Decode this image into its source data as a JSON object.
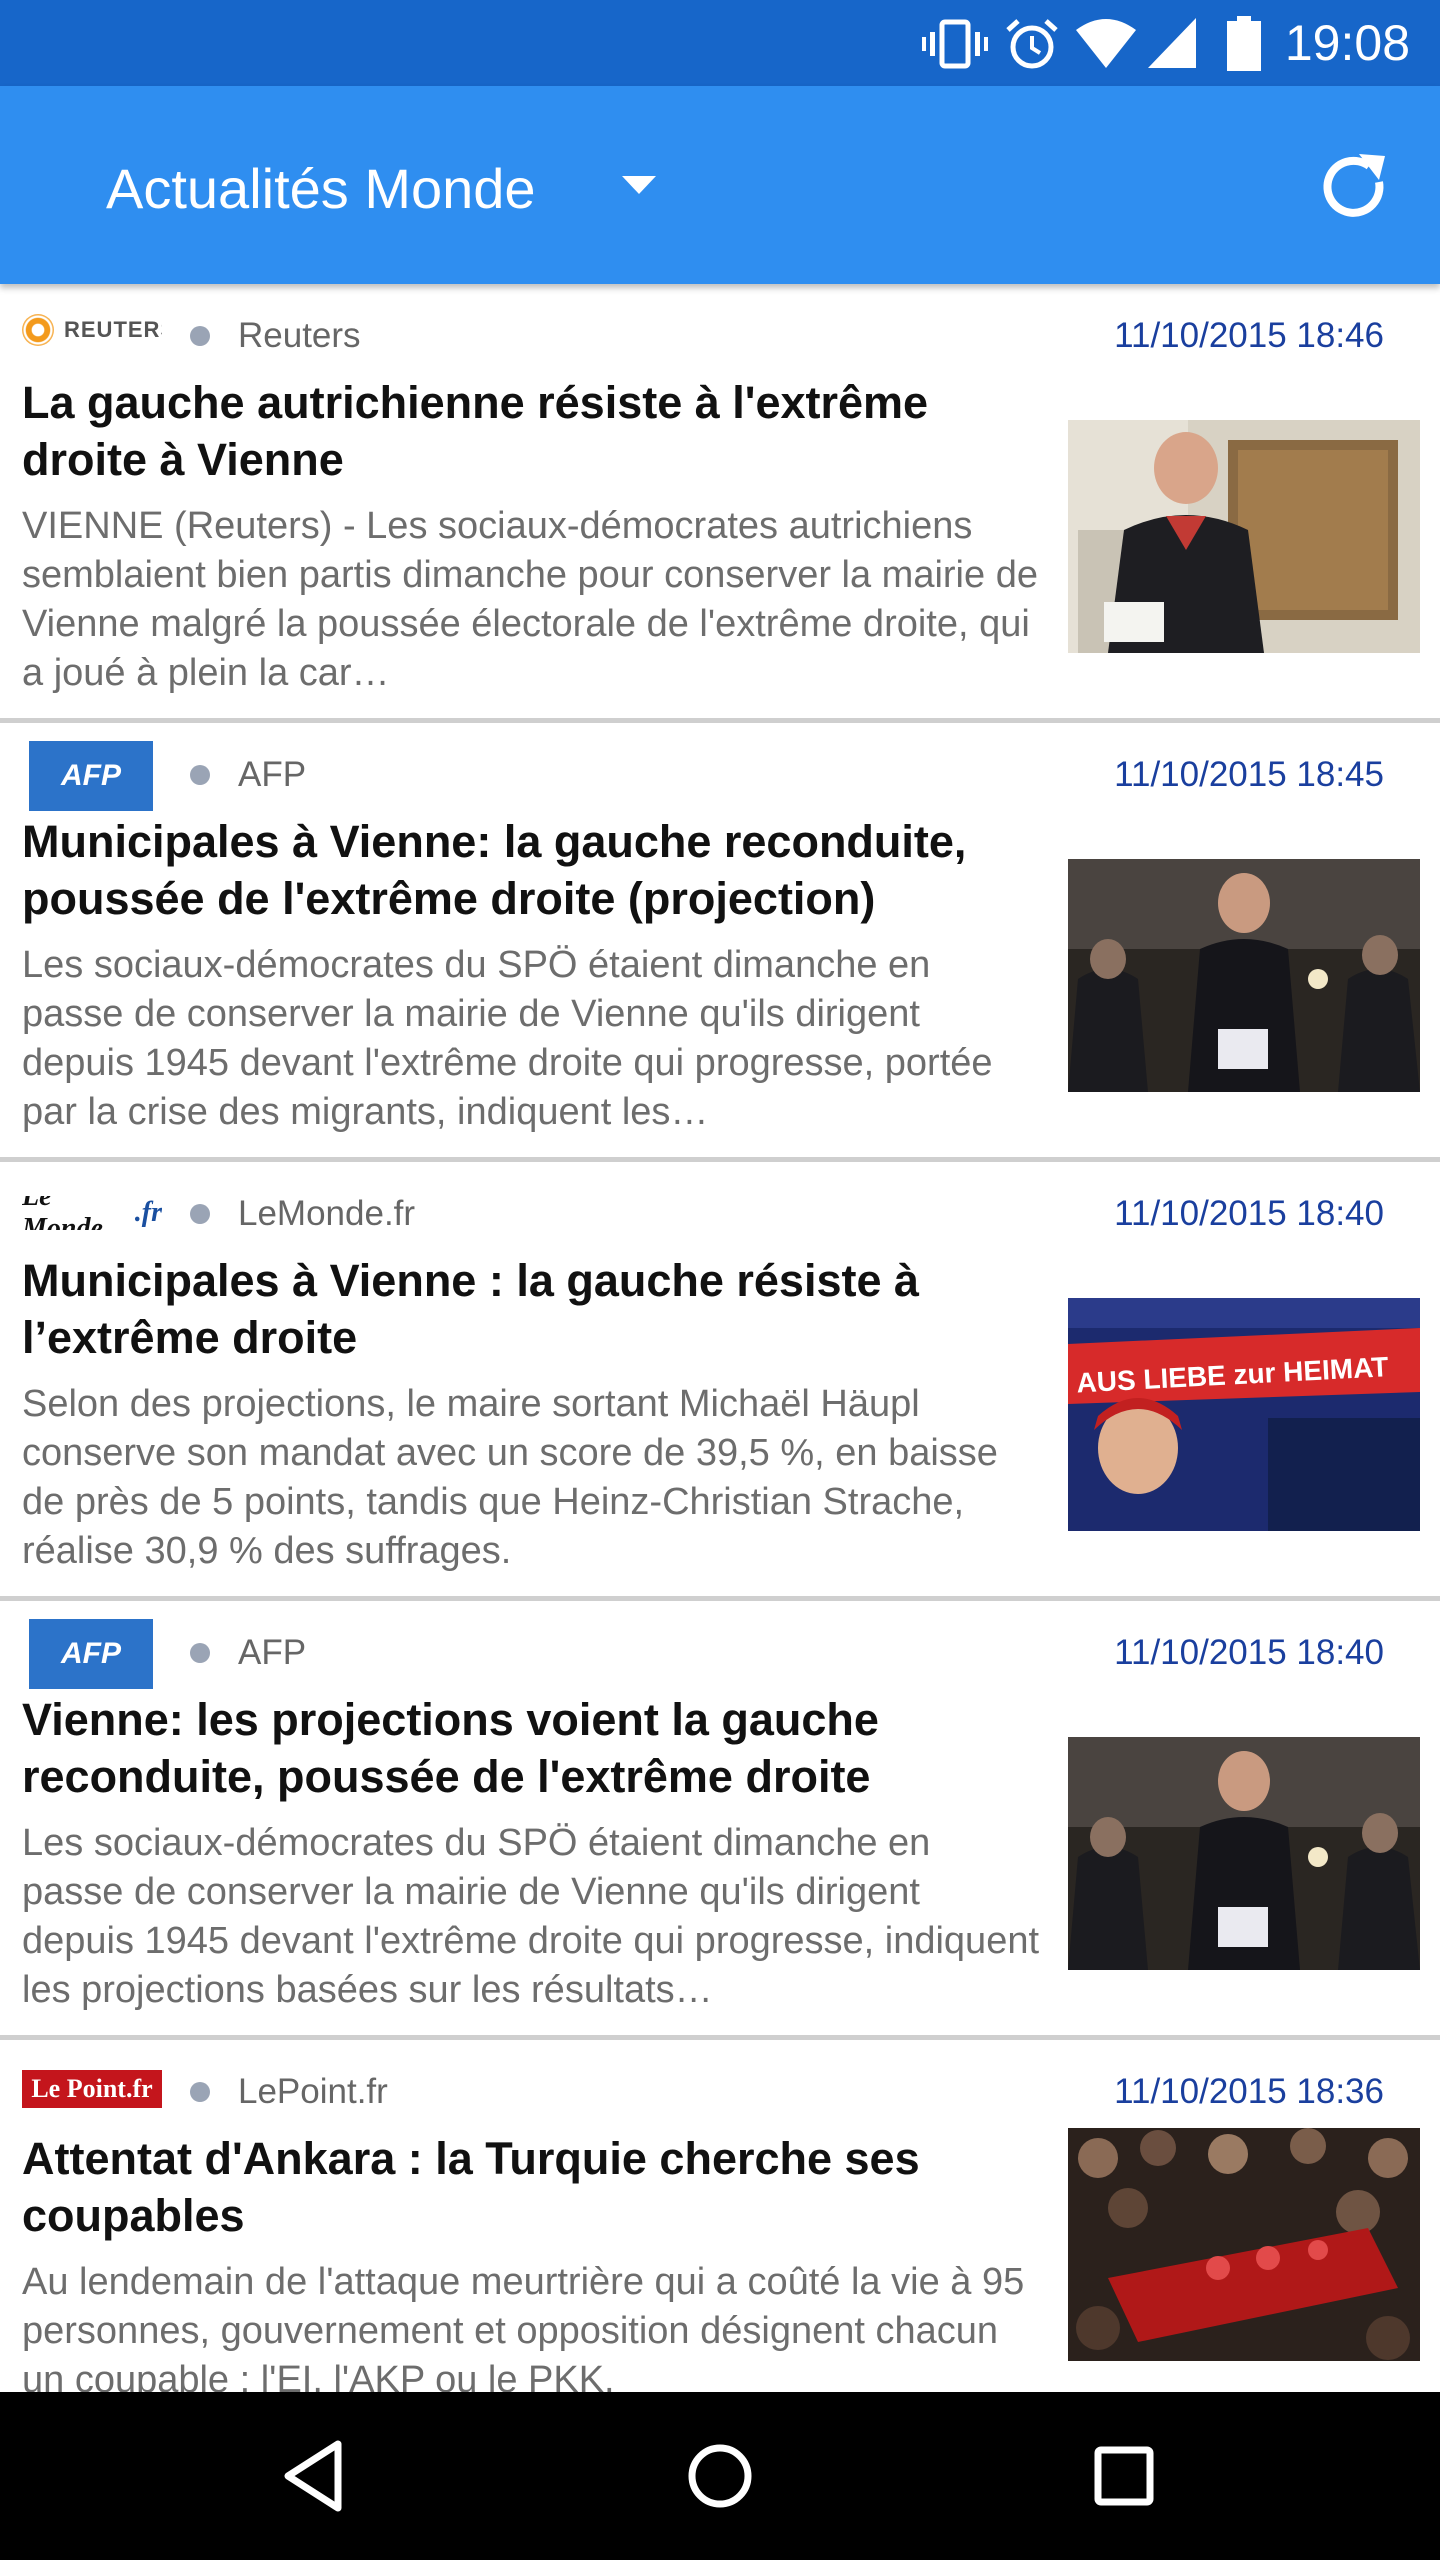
{
  "status_bar": {
    "time": "19:08",
    "icons": [
      "vibrate-icon",
      "alarm-icon",
      "wifi-icon",
      "signal-icon",
      "battery-icon"
    ]
  },
  "app_bar": {
    "title": "Actualités Monde",
    "dropdown_icon": "dropdown-arrow-icon",
    "refresh_icon": "refresh-icon"
  },
  "articles": [
    {
      "logo": "reuters-logo",
      "logo_text": "REUTERS",
      "source": "Reuters",
      "date": "11/10/2015 18:46",
      "title": "La gauche autrichienne résiste à l'extrême droite à Vienne",
      "summary": "VIENNE (Reuters) - Les sociaux-démocrates autrichiens semblaient bien partis dimanche pour conserver la mairie de Vienne malgré la poussée électorale de l'extrême droite, qui a joué à plein la car…"
    },
    {
      "logo": "afp-logo",
      "logo_text": "AFP",
      "source": "AFP",
      "date": "11/10/2015 18:45",
      "title": "Municipales à Vienne: la gauche reconduite, poussée de l'extrême droite (projection)",
      "summary": "Les sociaux-démocrates du SPÖ étaient dimanche en passe de conserver la mairie de Vienne qu'ils dirigent depuis 1945 devant l'extrême droite qui progresse, portée par la crise des migrants, indiquent les…"
    },
    {
      "logo": "lemonde-logo",
      "logo_text": "Le Monde",
      "logo_text_suffix": ".fr",
      "source": "LeMonde.fr",
      "date": "11/10/2015 18:40",
      "title": "Municipales à Vienne : la gauche résiste à l’extrême droite",
      "summary": "Selon des projections, le maire sortant Michaël Häupl conserve son mandat avec un score de 39,5 %, en baisse de près de 5 points, tandis que Heinz-Christian Strache, réalise 30,9 % des suffrages.",
      "image_text": "AUS LIEBE zur HEIMAT"
    },
    {
      "logo": "afp-logo",
      "logo_text": "AFP",
      "source": "AFP",
      "date": "11/10/2015 18:40",
      "title": "Vienne: les projections voient la gauche reconduite, poussée de l'extrême droite",
      "summary": "Les sociaux-démocrates du SPÖ étaient dimanche en passe de conserver la mairie de Vienne qu'ils dirigent depuis 1945 devant l'extrême droite qui progresse, indiquent les projections basées sur les résultats…"
    },
    {
      "logo": "lepoint-logo",
      "logo_text": "Le Point.fr",
      "source": "LePoint.fr",
      "date": "11/10/2015 18:36",
      "title": "Attentat d'Ankara : la Turquie cherche ses coupables",
      "summary": "Au lendemain de l'attaque meurtrière qui a coûté la vie à 95 personnes, gouvernement et opposition désignent chacun un coupable : l'EI, l'AKP ou le PKK."
    }
  ],
  "nav_bar": {
    "back_icon": "back-triangle-icon",
    "home_icon": "home-circle-icon",
    "recents_icon": "recents-square-icon"
  },
  "colors": {
    "status_bar": "#1766c9",
    "app_bar": "#2f8ef0",
    "date_text": "#1a3f9e",
    "divider": "#cfcfcf"
  }
}
